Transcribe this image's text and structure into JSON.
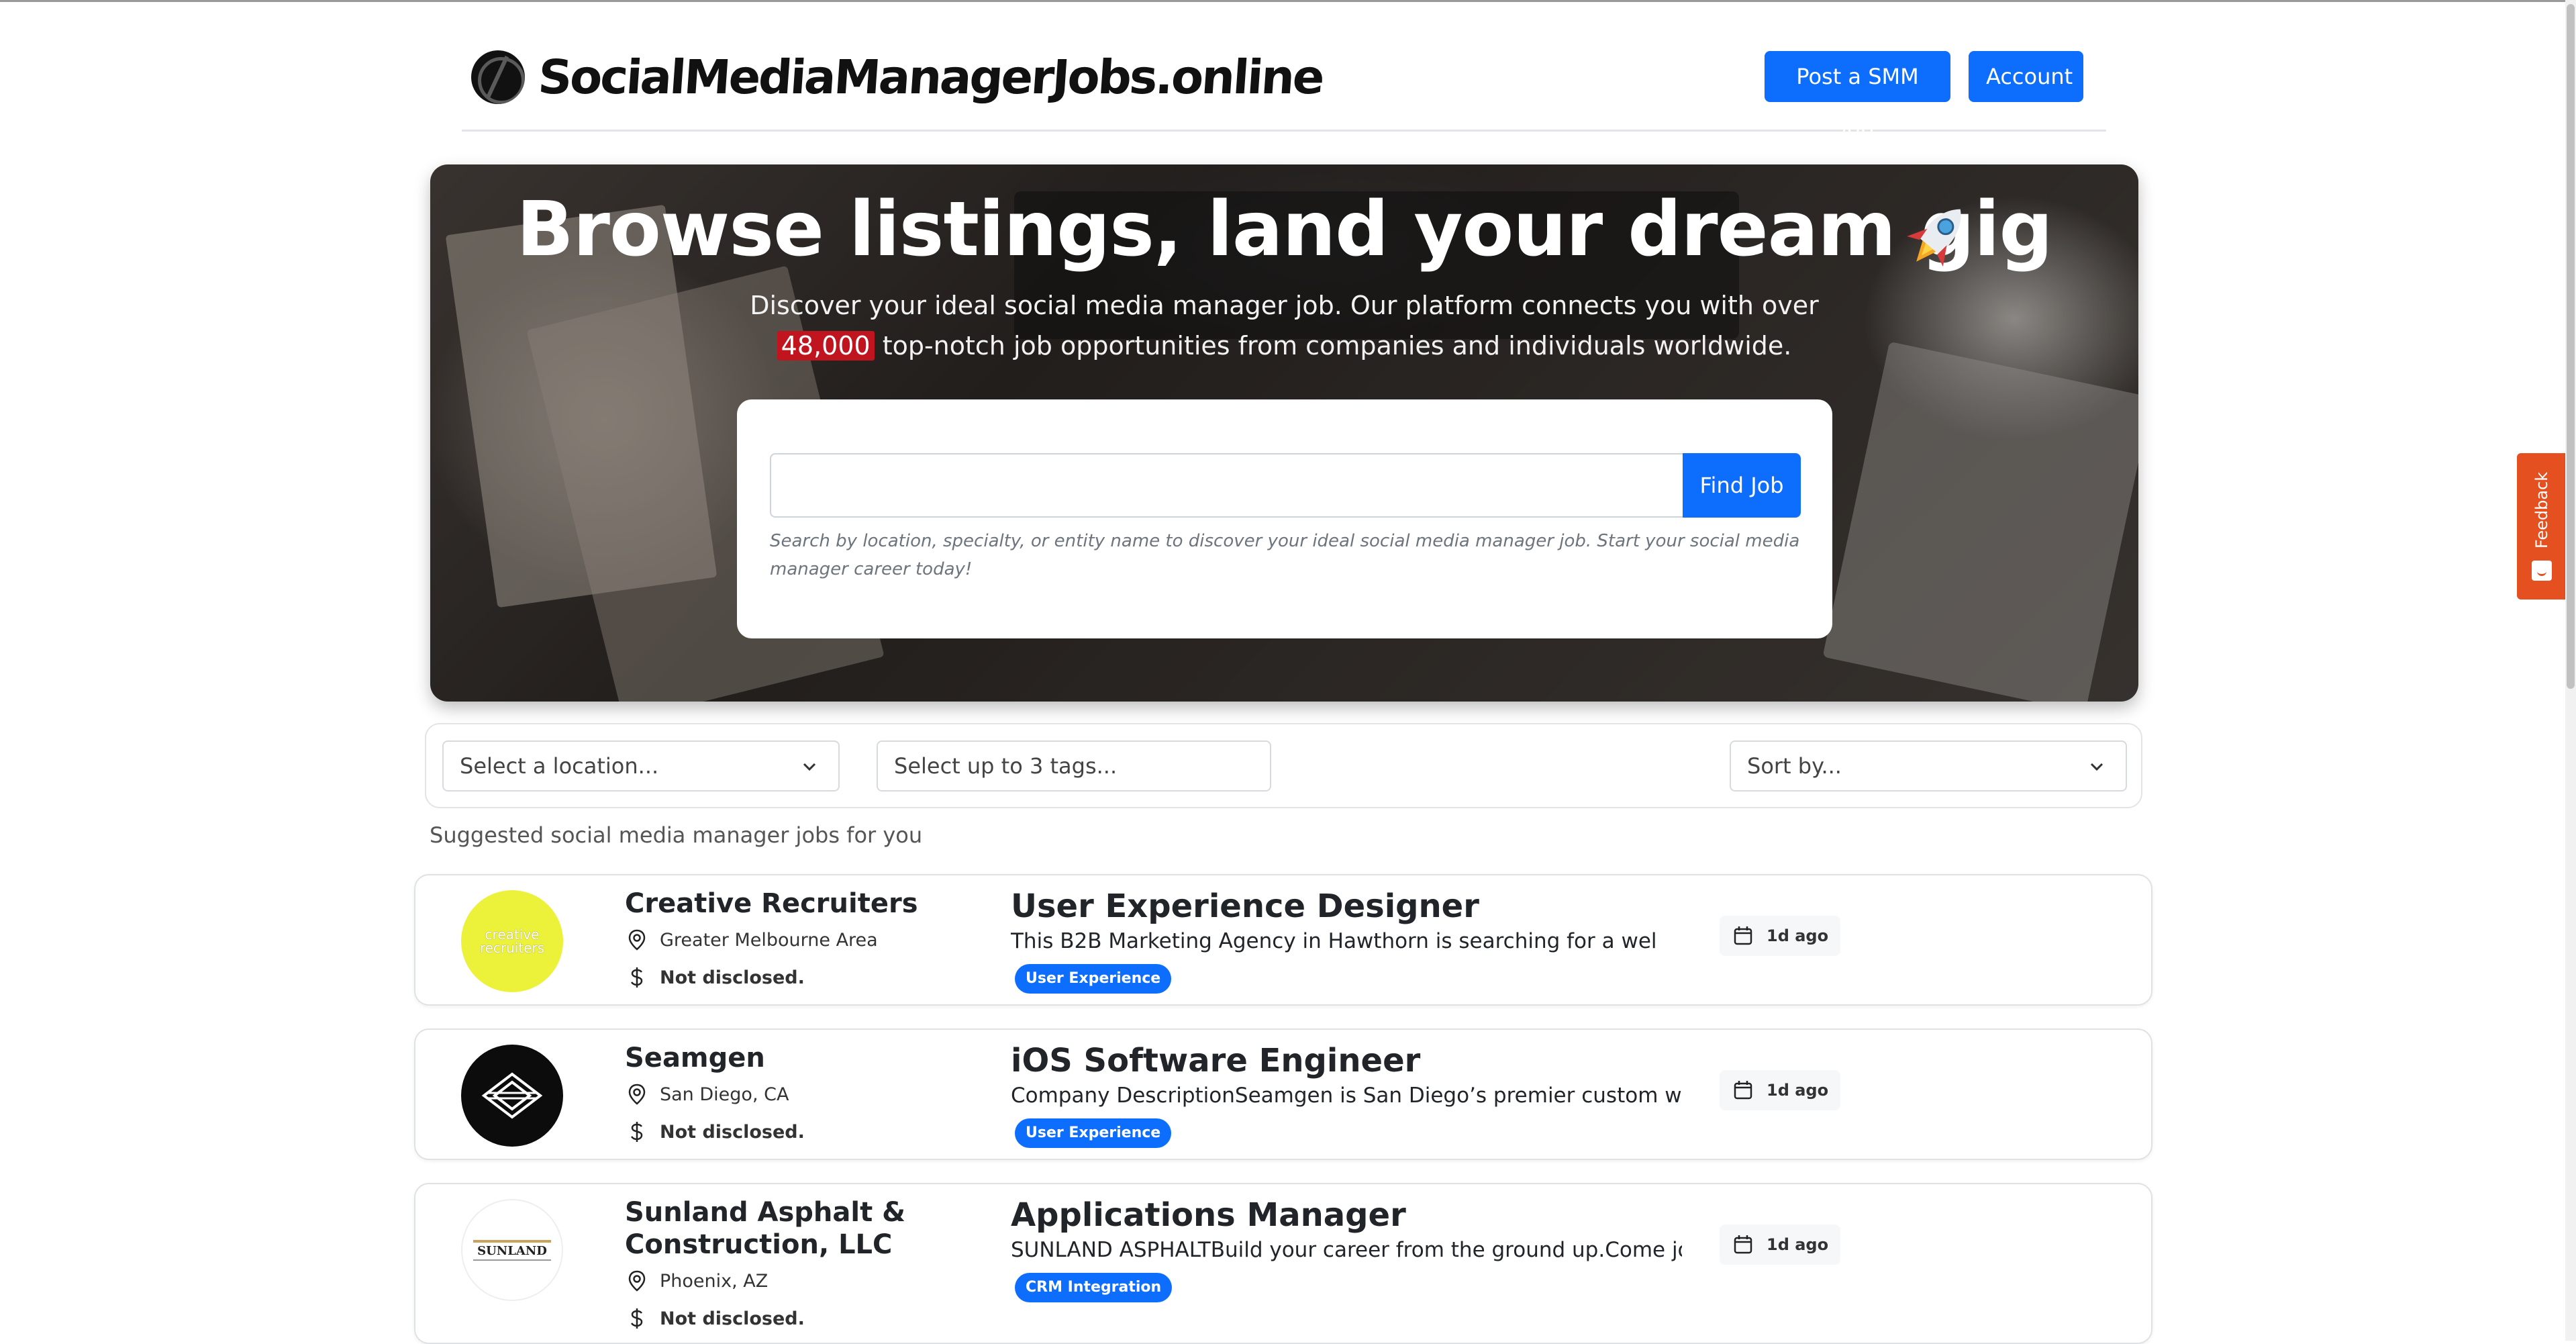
{
  "header": {
    "brand": "SocialMediaManagerJobs.online",
    "post_job_label": "Post a SMM job",
    "account_label": "Account"
  },
  "hero": {
    "title": "Browse listings, land your dream gig",
    "subtitle_before": "Discover your ideal social media manager job. Our platform connects you with over ",
    "highlight_count": "48,000",
    "subtitle_after": " top-notch job opportunities from companies and individuals worldwide.",
    "search": {
      "value": "",
      "placeholder": "",
      "button_label": "Find Job",
      "help_text": "Search by location, specialty, or entity name to discover your ideal social media manager job. Start your social media manager career today!"
    }
  },
  "filters": {
    "location_placeholder": "Select a location...",
    "tags_placeholder": "Select up to 3 tags...",
    "sort_placeholder": "Sort by..."
  },
  "suggested_heading": "Suggested social media manager jobs for you",
  "jobs": [
    {
      "company": "Creative Recruiters",
      "logo_text": "creative recruiters",
      "location": "Greater Melbourne Area",
      "salary": "Not disclosed.",
      "title": "User Experience Designer",
      "description": "This B2B Marketing Agency in Hawthorn is searching for a wel",
      "tag": "User Experience",
      "posted": "1d ago"
    },
    {
      "company": "Seamgen",
      "logo_text": "",
      "location": "San Diego, CA",
      "salary": "Not disclosed.",
      "title": "iOS Software Engineer",
      "description": "Company DescriptionSeamgen is San Diego’s premier custom web",
      "tag": "User Experience",
      "posted": "1d ago"
    },
    {
      "company": "Sunland Asphalt & Construction, LLC",
      "logo_text": "SUNLAND",
      "location": "Phoenix, AZ",
      "salary": "Not disclosed.",
      "title": "Applications Manager",
      "description": "SUNLAND ASPHALTBuild your career from the ground up.Come joi",
      "tag": "CRM Integration",
      "posted": "1d ago"
    }
  ],
  "feedback_label": "Feedback",
  "colors": {
    "primary": "#0d6efd",
    "highlight": "#c0141f",
    "feedback": "#e4501f",
    "logo_creative_recruiters": "#ecf13a"
  },
  "icons": {
    "location": "map-pin-icon",
    "salary": "dollar-icon",
    "date": "calendar-icon",
    "select": "chevron-down-icon",
    "hero_emoji": "rocket-icon"
  }
}
